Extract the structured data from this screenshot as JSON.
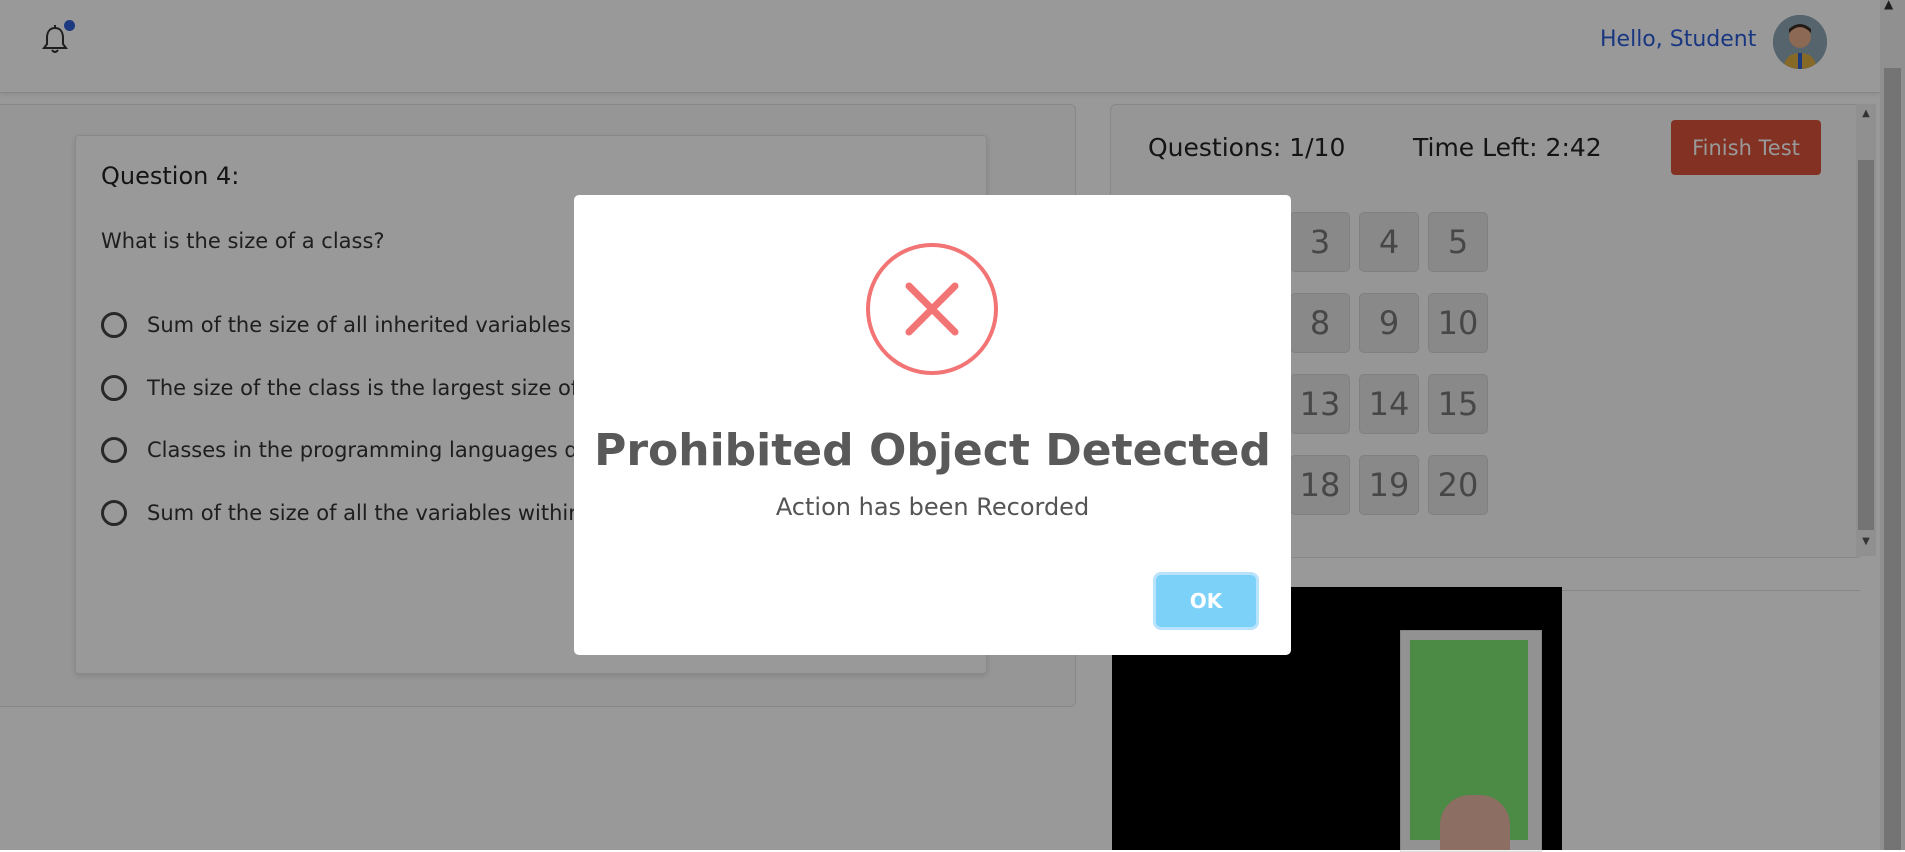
{
  "header": {
    "greeting": "Hello, Student"
  },
  "question": {
    "title": "Question 4:",
    "text": "What is the size of a class?",
    "options": [
      "Sum of the size of all inherited variables alon",
      "The size of the class is the largest size of the",
      "Classes in the programming languages do n",
      "Sum of the size of all the variables within a cla"
    ]
  },
  "test_status": {
    "questions_label": "Questions: 1/10",
    "time_left_label": "Time Left: 2:42",
    "finish_label": "Finish Test"
  },
  "question_numbers": [
    "3",
    "4",
    "5",
    "8",
    "9",
    "10",
    "13",
    "14",
    "15",
    "18",
    "19",
    "20"
  ],
  "dialog": {
    "icon": "error-x-icon",
    "title": "Prohibited Object Detected",
    "message": "Action has been Recorded",
    "ok_label": "OK"
  },
  "colors": {
    "accent_blue": "#2b5bd7",
    "finish_red": "#d9523a",
    "error_red": "#f27474",
    "ok_blue": "#7cd1f9"
  }
}
